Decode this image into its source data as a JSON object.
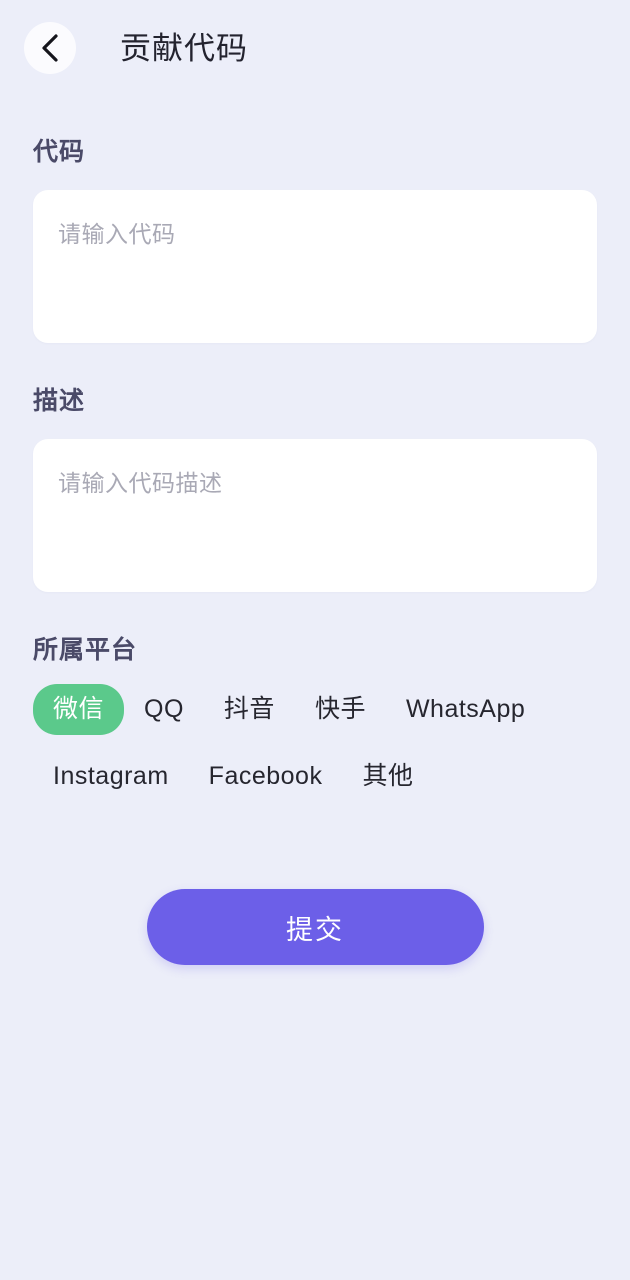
{
  "theme": {
    "background": "#eceef9",
    "card_background": "#ffffff",
    "accent_purple": "#6c5fe8",
    "accent_green": "#5bc98b",
    "label_color": "#4a4a68",
    "title_color": "#23232f",
    "placeholder_color": "#a9a9b5"
  },
  "header": {
    "title": "贡献代码",
    "back_icon": "chevron-left-icon"
  },
  "form": {
    "code": {
      "label": "代码",
      "placeholder": "请输入代码",
      "value": ""
    },
    "description": {
      "label": "描述",
      "placeholder": "请输入代码描述",
      "value": ""
    },
    "platform": {
      "label": "所属平台",
      "selected": "微信",
      "options": [
        "微信",
        "QQ",
        "抖音",
        "快手",
        "WhatsApp",
        "Instagram",
        "Facebook",
        "其他"
      ]
    },
    "submit_label": "提交"
  }
}
